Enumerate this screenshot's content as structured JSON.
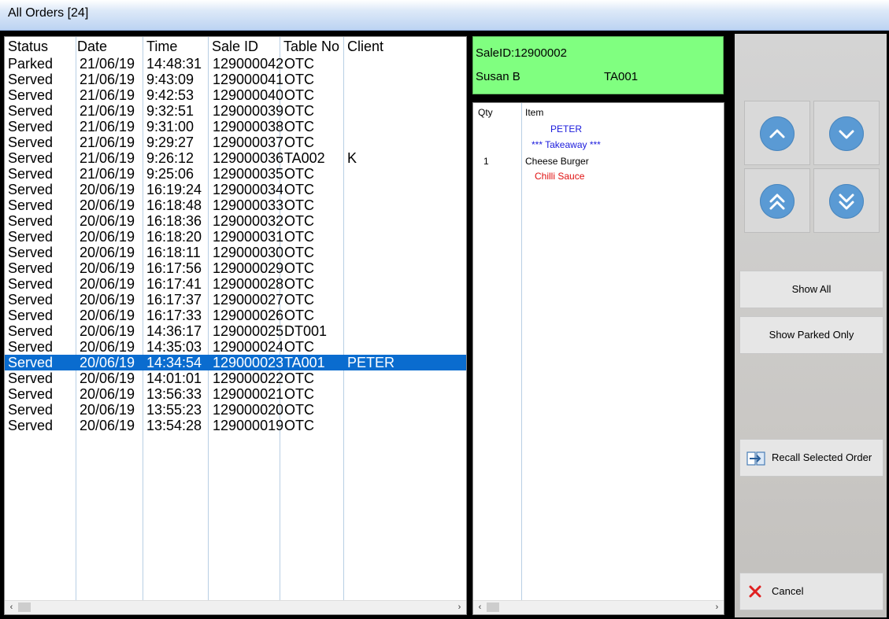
{
  "window": {
    "title": "All Orders [24]"
  },
  "orders": {
    "columns": [
      "Status",
      "Date",
      "Time",
      "Sale ID",
      "Table No",
      "Client"
    ],
    "rows": [
      {
        "status": "Parked",
        "date": "21/06/19",
        "time": "14:48:31",
        "sale_id": "129000042",
        "table": "OTC",
        "client": ""
      },
      {
        "status": "Served",
        "date": "21/06/19",
        "time": "9:43:09",
        "sale_id": "129000041",
        "table": "OTC",
        "client": ""
      },
      {
        "status": "Served",
        "date": "21/06/19",
        "time": "9:42:53",
        "sale_id": "129000040",
        "table": "OTC",
        "client": ""
      },
      {
        "status": "Served",
        "date": "21/06/19",
        "time": "9:32:51",
        "sale_id": "129000039",
        "table": "OTC",
        "client": ""
      },
      {
        "status": "Served",
        "date": "21/06/19",
        "time": "9:31:00",
        "sale_id": "129000038",
        "table": "OTC",
        "client": ""
      },
      {
        "status": "Served",
        "date": "21/06/19",
        "time": "9:29:27",
        "sale_id": "129000037",
        "table": "OTC",
        "client": ""
      },
      {
        "status": "Served",
        "date": "21/06/19",
        "time": "9:26:12",
        "sale_id": "129000036",
        "table": "TA002",
        "client": "K"
      },
      {
        "status": "Served",
        "date": "21/06/19",
        "time": "9:25:06",
        "sale_id": "129000035",
        "table": "OTC",
        "client": ""
      },
      {
        "status": "Served",
        "date": "20/06/19",
        "time": "16:19:24",
        "sale_id": "129000034",
        "table": "OTC",
        "client": ""
      },
      {
        "status": "Served",
        "date": "20/06/19",
        "time": "16:18:48",
        "sale_id": "129000033",
        "table": "OTC",
        "client": ""
      },
      {
        "status": "Served",
        "date": "20/06/19",
        "time": "16:18:36",
        "sale_id": "129000032",
        "table": "OTC",
        "client": ""
      },
      {
        "status": "Served",
        "date": "20/06/19",
        "time": "16:18:20",
        "sale_id": "129000031",
        "table": "OTC",
        "client": ""
      },
      {
        "status": "Served",
        "date": "20/06/19",
        "time": "16:18:11",
        "sale_id": "129000030",
        "table": "OTC",
        "client": ""
      },
      {
        "status": "Served",
        "date": "20/06/19",
        "time": "16:17:56",
        "sale_id": "129000029",
        "table": "OTC",
        "client": ""
      },
      {
        "status": "Served",
        "date": "20/06/19",
        "time": "16:17:41",
        "sale_id": "129000028",
        "table": "OTC",
        "client": ""
      },
      {
        "status": "Served",
        "date": "20/06/19",
        "time": "16:17:37",
        "sale_id": "129000027",
        "table": "OTC",
        "client": ""
      },
      {
        "status": "Served",
        "date": "20/06/19",
        "time": "16:17:33",
        "sale_id": "129000026",
        "table": "OTC",
        "client": ""
      },
      {
        "status": "Served",
        "date": "20/06/19",
        "time": "14:36:17",
        "sale_id": "129000025",
        "table": "DT001",
        "client": ""
      },
      {
        "status": "Served",
        "date": "20/06/19",
        "time": "14:35:03",
        "sale_id": "129000024",
        "table": "OTC",
        "client": ""
      },
      {
        "status": "Served",
        "date": "20/06/19",
        "time": "14:34:54",
        "sale_id": "129000023",
        "table": "TA001",
        "client": "PETER",
        "selected": true
      },
      {
        "status": "Served",
        "date": "20/06/19",
        "time": "14:01:01",
        "sale_id": "129000022",
        "table": "OTC",
        "client": ""
      },
      {
        "status": "Served",
        "date": "20/06/19",
        "time": "13:56:33",
        "sale_id": "129000021",
        "table": "OTC",
        "client": ""
      },
      {
        "status": "Served",
        "date": "20/06/19",
        "time": "13:55:23",
        "sale_id": "129000020",
        "table": "OTC",
        "client": ""
      },
      {
        "status": "Served",
        "date": "20/06/19",
        "time": "13:54:28",
        "sale_id": "129000019",
        "table": "OTC",
        "client": ""
      }
    ]
  },
  "sale_header": {
    "sale_id_text": "SaleID:12900002",
    "customer": "Susan B",
    "table": "TA001",
    "color": "#80ff80"
  },
  "sale_items": {
    "columns": {
      "qty": "Qty",
      "item": "Item"
    },
    "lines": [
      {
        "qty": "",
        "text": "PETER",
        "color": "#1a1adc"
      },
      {
        "qty": "",
        "text": "*** Takeaway ***",
        "color": "#1a1adc"
      },
      {
        "qty": "1",
        "text": "Cheese Burger",
        "color": "#000000"
      },
      {
        "qty": "",
        "text": "Chilli Sauce",
        "color": "#e01010"
      }
    ]
  },
  "controls": {
    "nav_icons": [
      "chevron-up-icon",
      "chevron-down-icon",
      "double-chevron-up-icon",
      "double-chevron-down-icon"
    ],
    "show_all": "Show All",
    "show_parked_only": "Show Parked Only",
    "recall_selected_order": "Recall Selected Order",
    "cancel": "Cancel"
  },
  "colors": {
    "selection": "#0a6ccf",
    "accent_button": "#5a9ad4",
    "cancel_icon": "#e02020"
  }
}
